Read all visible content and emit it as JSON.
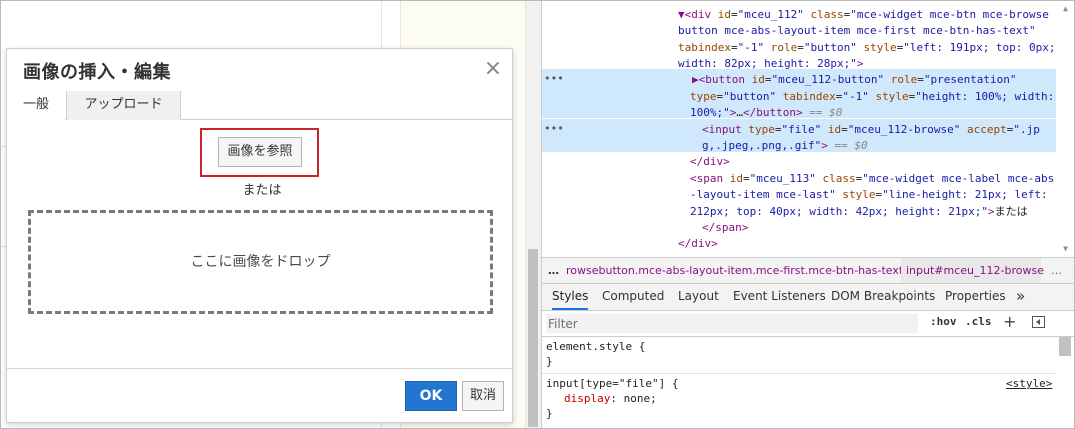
{
  "dialog": {
    "title": "画像の挿入・編集",
    "close_glyph": "×",
    "tabs": [
      {
        "label": "一般",
        "active": false
      },
      {
        "label": "アップロード",
        "active": true
      }
    ],
    "browse_label": "画像を参照",
    "or_label": "または",
    "drop_label": "ここに画像をドロップ",
    "ok_label": "OK",
    "cancel_label": "取消"
  },
  "devtools": {
    "dom_lines": [
      {
        "html": "<span class=\"tag\">▼&lt;div</span> <span class=\"attr\">id</span>=<span class=\"val\">\"mceu_112\"</span> <span class=\"attr\">class</span>=<span class=\"val\">\"mce-widget mce-btn mce-browse</span>"
      },
      {
        "html": "<span class=\"val\">button mce-abs-layout-item mce-first mce-btn-has-text\"</span>"
      },
      {
        "html": "<span class=\"attr\">tabindex</span>=<span class=\"val\">\"-1\"</span> <span class=\"attr\">role</span>=<span class=\"val\">\"button\"</span> <span class=\"attr\">style</span>=<span class=\"val\">\"left: 191px; top: 0px;</span>"
      },
      {
        "html": "<span class=\"val\">width: 82px; height: 28px;\"</span><span class=\"tag\">&gt;</span>"
      },
      {
        "html": "<span class=\"tag\">▶&lt;button</span> <span class=\"attr\">id</span>=<span class=\"val\">\"mceu_112-button\"</span> <span class=\"attr\">role</span>=<span class=\"val\">\"presentation\"</span>"
      },
      {
        "html": "<span class=\"attr\">type</span>=<span class=\"val\">\"button\"</span> <span class=\"attr\">tabindex</span>=<span class=\"val\">\"-1\"</span> <span class=\"attr\">style</span>=<span class=\"val\">\"height: 100%; width:</span>"
      },
      {
        "html": "<span class=\"val\">100%;\"</span><span class=\"tag\">&gt;</span>…<span class=\"tag\">&lt;/button&gt;</span> <span class=\"eq0\">== $0</span>"
      },
      {
        "html": "<span class=\"tag\">&lt;input</span> <span class=\"attr\">type</span>=<span class=\"val\">\"file\"</span> <span class=\"attr\">id</span>=<span class=\"val\">\"mceu_112-browse\"</span> <span class=\"attr\">accept</span>=<span class=\"val\">\".jp</span>"
      },
      {
        "html": "<span class=\"val\">g,.jpeg,.png,.gif\"</span><span class=\"tag\">&gt;</span> <span class=\"eq0\">== $0</span>"
      },
      {
        "html": "<span class=\"tag\">&lt;/div&gt;</span>"
      },
      {
        "html": "<span class=\"tag\">&lt;span</span> <span class=\"attr\">id</span>=<span class=\"val\">\"mceu_113\"</span> <span class=\"attr\">class</span>=<span class=\"val\">\"mce-widget mce-label mce-abs</span>"
      },
      {
        "html": "<span class=\"val\">-layout-item mce-last\"</span> <span class=\"attr\">style</span>=<span class=\"val\">\"line-height: 21px; left:</span>"
      },
      {
        "html": "<span class=\"val\">212px; top: 40px; width: 42px; height: 21px;\"</span><span class=\"tag\">&gt;</span><span class=\"txt\">または</span>"
      },
      {
        "html": "<span class=\"tag\">&lt;/span&gt;</span>"
      },
      {
        "html": "<span class=\"tag\">&lt;/div&gt;</span>"
      }
    ],
    "breadcrumb": {
      "dots": "…",
      "item1": "rowsebutton.mce-abs-layout-item.mce-first.mce-btn-has-text",
      "item2": "input#mceu_112-browse",
      "more": "…"
    },
    "panel_tabs": [
      "Styles",
      "Computed",
      "Layout",
      "Event Listeners",
      "DOM Breakpoints",
      "Properties"
    ],
    "more_tabs": "»",
    "filter_placeholder": "Filter",
    "hov_label": ":hov",
    "cls_label": ".cls",
    "plus_label": "+",
    "rules": {
      "element_style_open": "element.style {",
      "element_style_close": "}",
      "input_selector": "input[type=\"file\"] {",
      "input_prop": "display",
      "input_val": "none;",
      "input_close": "}",
      "input_source": "<style>"
    }
  }
}
